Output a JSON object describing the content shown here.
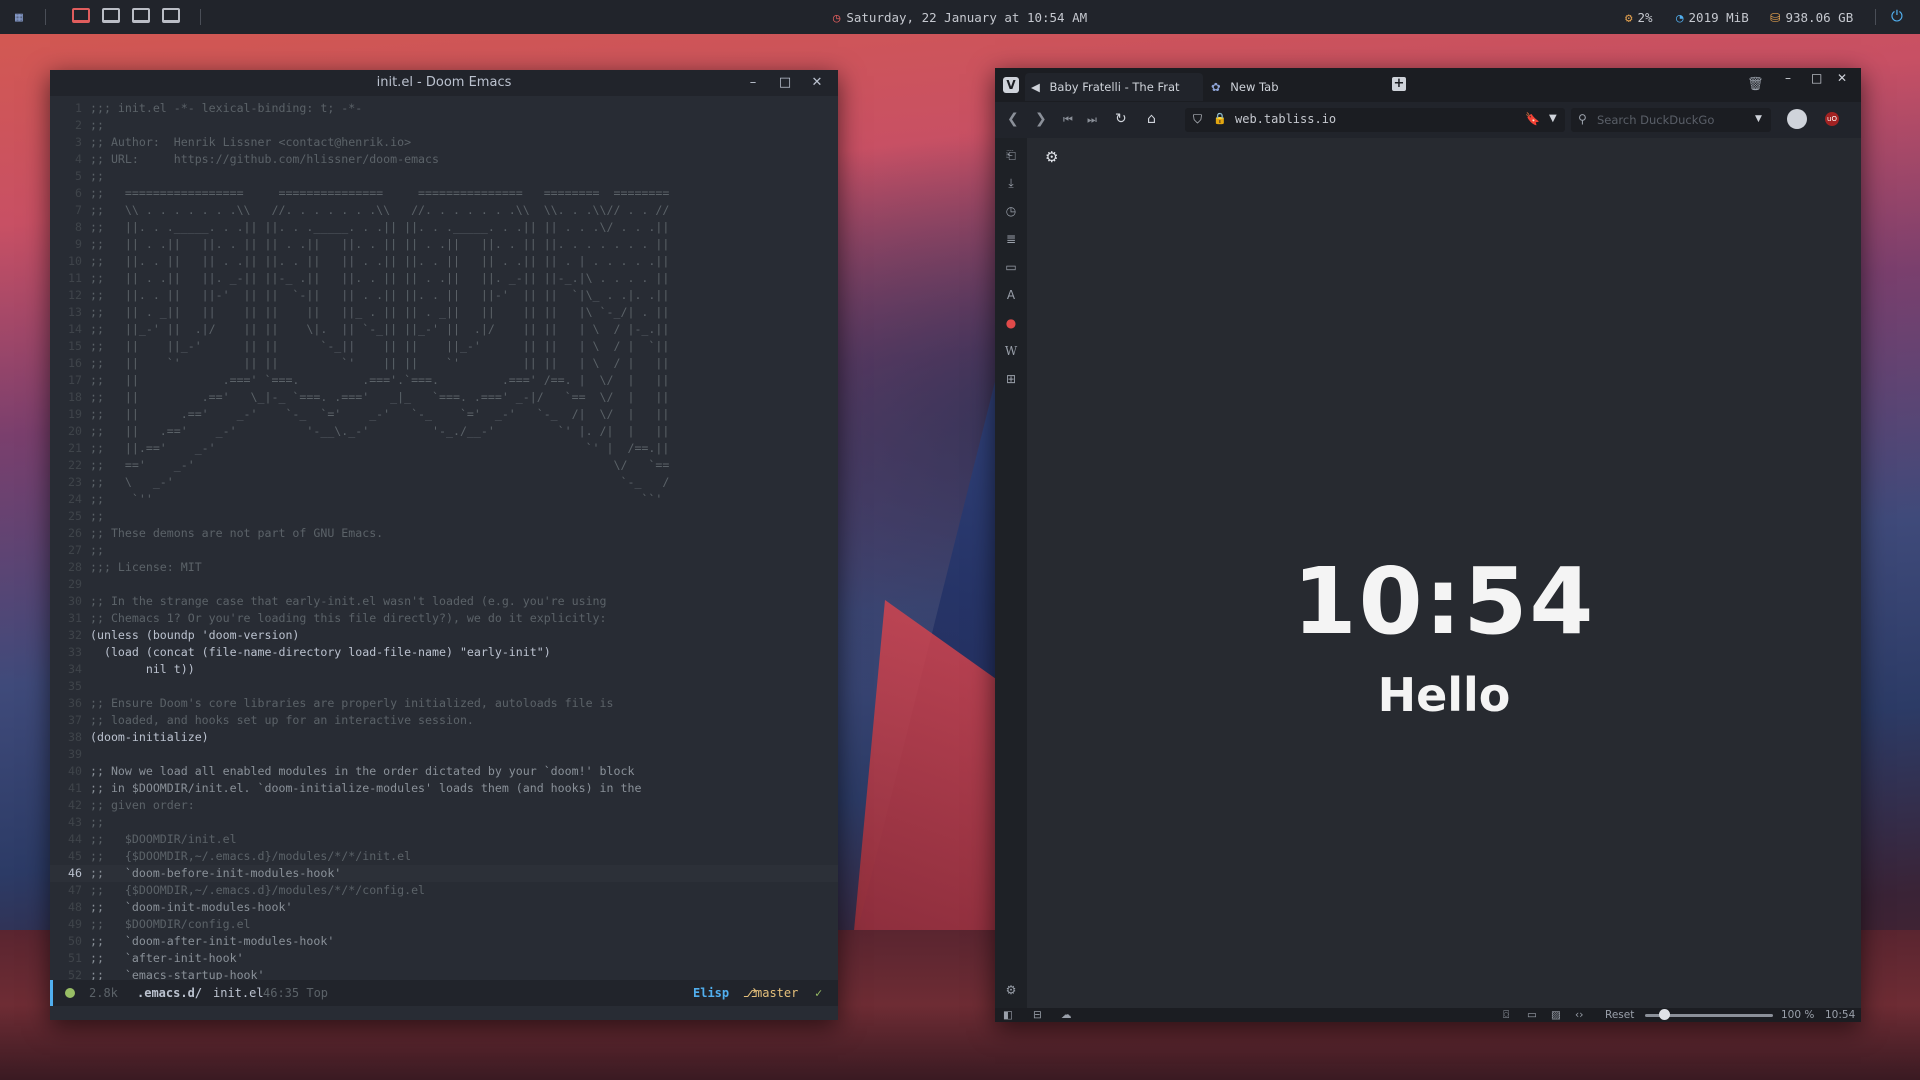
{
  "topbar": {
    "datetime": "Saturday, 22 January at 10:54 AM",
    "cpu": "2%",
    "memory": "2019 MiB",
    "disk": "938.06 GB",
    "workspaces": 4,
    "accent": "#e05d5d"
  },
  "emacs": {
    "title": "init.el - Doom Emacs",
    "modeline": {
      "size": "2.8k",
      "dir": ".emacs.d/",
      "file": "init.el",
      "position": "46:35 Top",
      "mode": "Elisp",
      "branch": "master"
    },
    "current_line": 46,
    "lines": [
      ";;; init.el -*- lexical-binding: t; -*-",
      ";;",
      ";; Author:  Henrik Lissner <contact@henrik.io>",
      ";; URL:     https://github.com/hlissner/doom-emacs",
      ";;",
      ";;   =================     ===============     ===============   ========  ========",
      ";;   \\\\ . . . . . . .\\\\   //. . . . . . .\\\\   //. . . . . . .\\\\  \\\\. . .\\\\// . . //",
      ";;   ||. . ._____. . .|| ||. . ._____. . .|| ||. . ._____. . .|| || . . .\\/ . . .||",
      ";;   || . .||   ||. . || || . .||   ||. . || || . .||   ||. . || ||. . . . . . . ||",
      ";;   ||. . ||   || . .|| ||. . ||   || . .|| ||. . ||   || . .|| || . | . . . . .||",
      ";;   || . .||   ||. _-|| ||-_ .||   ||. . || || . .||   ||. _-|| ||-_.|\\ . . . . ||",
      ";;   ||. . ||   ||-'  || ||  `-||   || . .|| ||. . ||   ||-'  || ||  `|\\_ . .|. .||",
      ";;   || . _||   ||    || ||    ||   ||_ . || || . _||   ||    || ||   |\\ `-_/| . ||",
      ";;   ||_-' ||  .|/    || ||    \\|.  || `-_|| ||_-' ||  .|/    || ||   | \\  / |-_.||",
      ";;   ||    ||_-'      || ||      `-_||    || ||    ||_-'      || ||   | \\  / |  `||",
      ";;   ||    `'         || ||         `'    || ||    `'         || ||   | \\  / |   ||",
      ";;   ||            .===' `===.         .==='.`===.         .===' /==. |  \\/  |   ||",
      ";;   ||         .=='   \\_|-_ `===. .==='   _|_   `===. .===' _-|/   `==  \\/  |   ||",
      ";;   ||      .=='    _-'    `-_  `='    _-'   `-_    `='  _-'   `-_  /|  \\/  |   ||",
      ";;   ||   .=='    _-'          '-__\\._-'         '-_./__-'         `' |. /|  |   ||",
      ";;   ||.=='    _-'                                                     `' |  /==.||",
      ";;   =='    _-'                                                            \\/   `==",
      ";;   \\   _-'                                                                `-_   /",
      ";;    `''                                                                      ``'",
      ";;",
      ";; These demons are not part of GNU Emacs.",
      ";;",
      ";;; License: MIT",
      "",
      ";; In the strange case that early-init.el wasn't loaded (e.g. you're using",
      ";; Chemacs 1? Or you're loading this file directly?), we do it explicitly:",
      "(unless (boundp 'doom-version)",
      "  (load (concat (file-name-directory load-file-name) \"early-init\")",
      "        nil t))",
      "",
      ";; Ensure Doom's core libraries are properly initialized, autoloads file is",
      ";; loaded, and hooks set up for an interactive session.",
      "(doom-initialize)",
      "",
      ";; Now we load all enabled modules in the order dictated by your `doom!' block",
      ";; in $DOOMDIR/init.el. `doom-initialize-modules' loads them (and hooks) in the",
      ";; given order:",
      ";;",
      ";;   $DOOMDIR/init.el",
      ";;   {$DOOMDIR,~/.emacs.d}/modules/*/*/init.el",
      ";;   `doom-before-init-modules-hook'",
      ";;   {$DOOMDIR,~/.emacs.d}/modules/*/*/config.el",
      ";;   `doom-init-modules-hook'",
      ";;   $DOOMDIR/config.el",
      ";;   `doom-after-init-modules-hook'",
      ";;   `after-init-hook'",
      ";;   `emacs-startup-hook'"
    ]
  },
  "browser": {
    "tabs": [
      {
        "label": "Baby Fratelli - The Frat"
      },
      {
        "label": "New Tab"
      }
    ],
    "url": "web.tabliss.io",
    "search_placeholder": "Search DuckDuckGo",
    "page": {
      "clock": "10:54",
      "greeting": "Hello"
    },
    "status": {
      "reset": "Reset",
      "zoom": "100 %",
      "zoom_fraction": 0.15,
      "time": "10:54"
    }
  }
}
